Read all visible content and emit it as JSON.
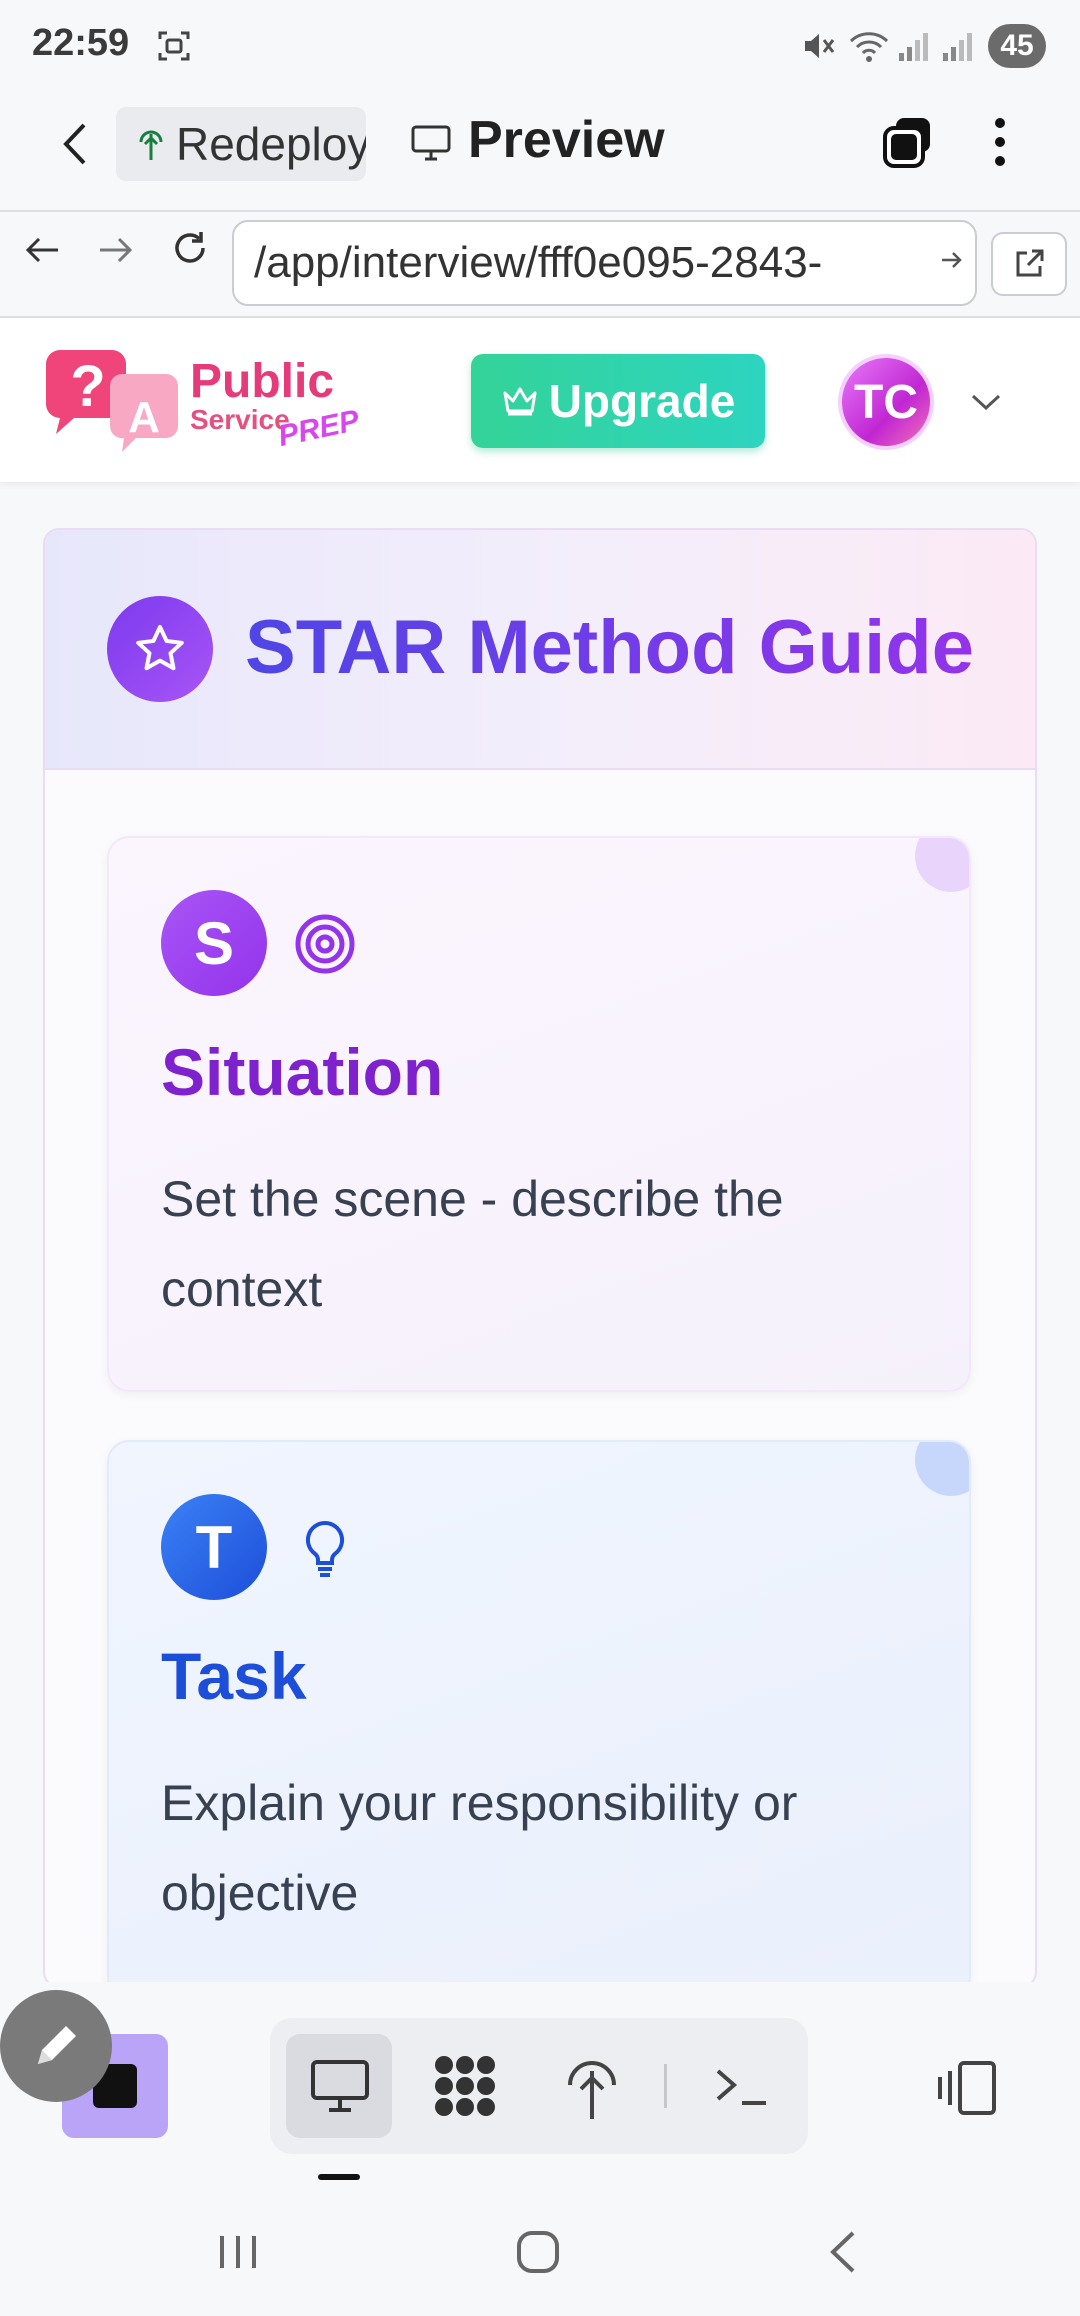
{
  "status_bar": {
    "time": "22:59",
    "battery": "45"
  },
  "app_bar": {
    "chip_label": "Redeploy",
    "title": "Preview"
  },
  "browser": {
    "url": "/app/interview/fff0e095-2843-"
  },
  "header": {
    "logo_line1": "Public",
    "logo_line2": "Service",
    "logo_line3": "PREP",
    "upgrade_label": "Upgrade",
    "avatar_initials": "TC"
  },
  "guide": {
    "title": "STAR Method Guide",
    "steps": [
      {
        "letter": "S",
        "title": "Situation",
        "description": "Set the scene - describe the context",
        "icon": "target-icon",
        "color": "#7e22ce"
      },
      {
        "letter": "T",
        "title": "Task",
        "description": "Explain your responsibility or objective",
        "icon": "lightbulb-icon",
        "color": "#1d4ed8"
      }
    ]
  },
  "colors": {
    "accent_green": "#34d399",
    "purple": "#7c3aed",
    "blue": "#2563eb"
  }
}
